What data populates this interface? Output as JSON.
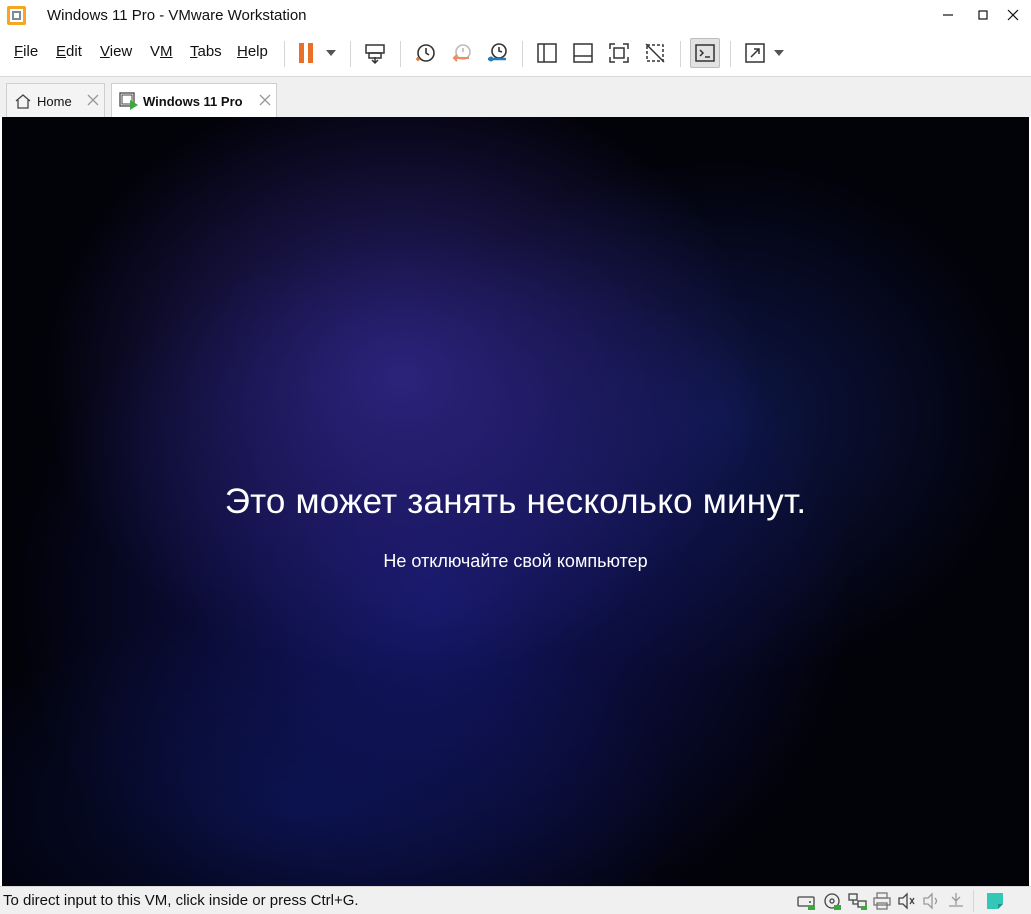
{
  "window": {
    "title": "Windows 11 Pro - VMware Workstation",
    "app_icon": "vmware-workstation-icon",
    "controls": [
      "minimize-icon",
      "maximize-icon",
      "close-icon"
    ]
  },
  "menu": {
    "items": [
      {
        "label": "File",
        "accelerator": "F"
      },
      {
        "label": "Edit",
        "accelerator": "E"
      },
      {
        "label": "View",
        "accelerator": "V"
      },
      {
        "label": "VM",
        "accelerator": "M"
      },
      {
        "label": "Tabs",
        "accelerator": "T"
      },
      {
        "label": "Help",
        "accelerator": "H"
      }
    ]
  },
  "toolbar": {
    "buttons": [
      "pause-icon",
      "dropdown-arrow-icon",
      "send-ctrl-alt-del-icon",
      "snapshot-take-icon",
      "snapshot-revert-icon",
      "snapshot-manager-icon",
      "show-library-icon",
      "thumbnail-bar-icon",
      "fullscreen-icon",
      "unity-icon",
      "console-view-icon",
      "stretch-guest-icon",
      "dropdown-arrow-icon"
    ],
    "colors": {
      "pause": "#e8712a",
      "snapshot_revert": "#f08a5d",
      "snapshot_manager": "#2a7ab8"
    }
  },
  "tabs": [
    {
      "label": "Home",
      "icon": "home-icon",
      "active": false
    },
    {
      "label": "Windows 11 Pro",
      "icon": "vm-running-icon",
      "active": true
    }
  ],
  "console": {
    "title": "Это может занять несколько минут.",
    "subtitle": "Не отключайте свой компьютер",
    "colors": {
      "background": "#020209",
      "glow": "#2e2480",
      "text": "#ffffff"
    }
  },
  "status": {
    "message": "To direct input to this VM, click inside or press Ctrl+G.",
    "devices": [
      "hard-disk-icon",
      "cd-dvd-icon",
      "network-adapter-icon",
      "printer-icon",
      "sound-card-icon",
      "sound-muted-icon",
      "usb-icon",
      "message-log-icon"
    ]
  }
}
